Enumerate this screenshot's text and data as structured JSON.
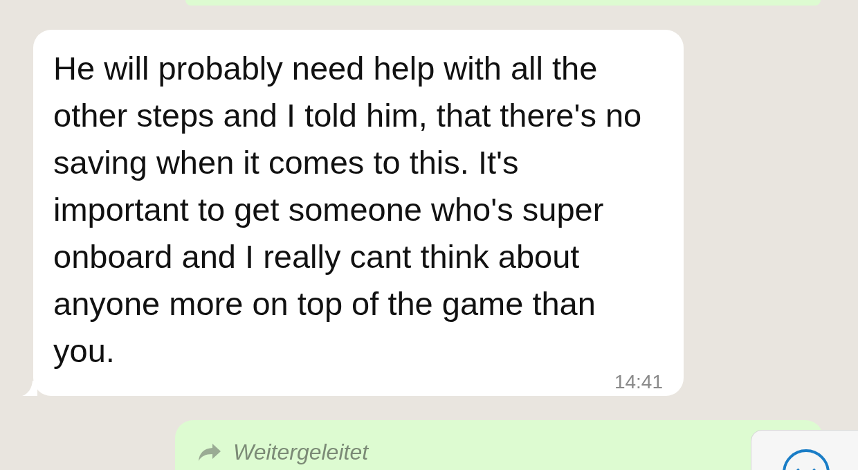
{
  "messages": [
    {
      "kind": "outgoing"
    },
    {
      "kind": "incoming",
      "text": "He will probably need help with all the other steps and I told him, that there's no saving when it comes to this. It's important to get someone who's super onboard and I really cant think about anyone more on top of the game than you.",
      "time": "14:41"
    },
    {
      "kind": "outgoing",
      "forwarded_label": "Weitergeleitet"
    }
  ],
  "scroll_button": {
    "kind": "scroll-down"
  }
}
